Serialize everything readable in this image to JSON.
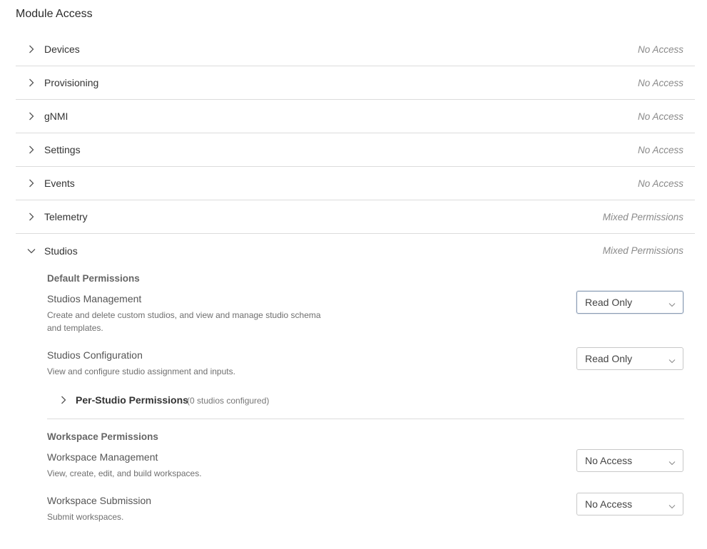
{
  "page": {
    "title": "Module Access"
  },
  "modules": [
    {
      "name": "Devices",
      "status": "No Access"
    },
    {
      "name": "Provisioning",
      "status": "No Access"
    },
    {
      "name": "gNMI",
      "status": "No Access"
    },
    {
      "name": "Settings",
      "status": "No Access"
    },
    {
      "name": "Events",
      "status": "No Access"
    },
    {
      "name": "Telemetry",
      "status": "Mixed Permissions"
    },
    {
      "name": "Studios",
      "status": "Mixed Permissions"
    }
  ],
  "studios": {
    "default_section": "Default Permissions",
    "management": {
      "name": "Studios Management",
      "description": "Create and delete custom studios, and view and manage studio schema and templates.",
      "value": "Read Only"
    },
    "configuration": {
      "name": "Studios Configuration",
      "description": "View and configure studio assignment and inputs.",
      "value": "Read Only"
    },
    "per_studio": {
      "title": "Per-Studio Permissions",
      "count": "(0 studios configured)"
    },
    "workspace_section": "Workspace Permissions",
    "workspace_management": {
      "name": "Workspace Management",
      "description": "View, create, edit, and build workspaces.",
      "value": "No Access"
    },
    "workspace_submission": {
      "name": "Workspace Submission",
      "description": "Submit workspaces.",
      "value": "No Access"
    }
  }
}
